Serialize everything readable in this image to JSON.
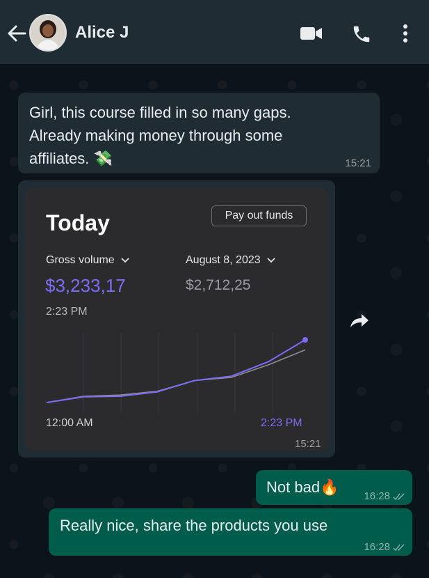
{
  "header": {
    "contact_name": "Alice J"
  },
  "messages": {
    "first": {
      "text_line1": "Girl, this course filled in so many gaps.",
      "text_line2": "Already making money through some",
      "text_line3": "affiliates. 💸",
      "time": "15:21"
    },
    "image": {
      "time": "15:21"
    },
    "second": {
      "text": "Not bad🔥",
      "time": "16:28"
    },
    "third": {
      "text": "Really nice, share the products you use",
      "time": "16:28"
    }
  },
  "dashboard": {
    "title": "Today",
    "payout_label": "Pay out funds",
    "gross_label": "Gross volume",
    "date_label": "August 8, 2023",
    "gross_value": "$3,233,17",
    "compare_value": "$2,712,25",
    "time_label": "2:23 PM",
    "axis_start": "12:00 AM",
    "axis_end": "2:23 PM"
  },
  "chart_data": {
    "type": "line",
    "series": [
      {
        "values": [
          0,
          0.09,
          0.1,
          0.17,
          0.35,
          0.42,
          0.65,
          1.0
        ]
      },
      {
        "values": [
          0,
          0.1,
          0.12,
          0.18,
          0.35,
          0.4,
          0.6,
          0.84
        ]
      }
    ],
    "ylim": [
      0,
      1
    ]
  },
  "colors": {
    "accent_purple": "#7b6cf6",
    "outgoing_bubble": "#005c4b",
    "incoming_bubble": "#1f2c33"
  }
}
